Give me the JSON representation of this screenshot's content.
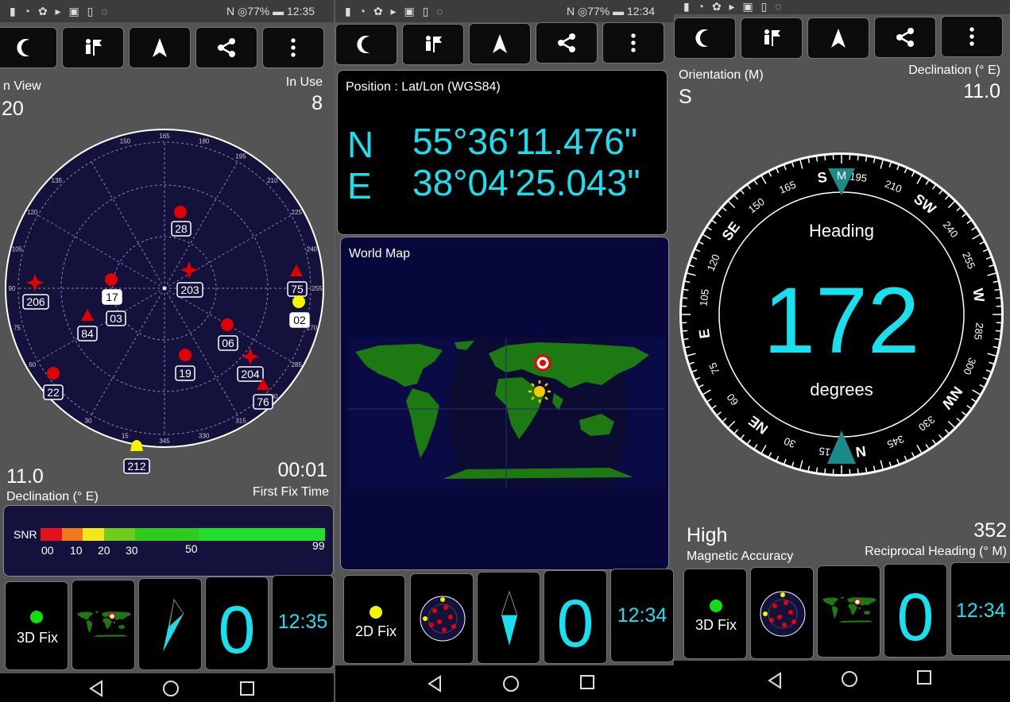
{
  "screens": [
    {
      "status": {
        "left": "▮ ◔ ✿ ▸ ▣ ▯ ◌",
        "right": "N ◎77% ▬ 12:35"
      },
      "toolbar": {
        "icons": [
          "night-mode-icon",
          "poi-icon",
          "navigate-icon",
          "share-icon",
          "more-vert-icon"
        ]
      },
      "in_view_label": "n View",
      "in_view_value": "20",
      "in_use_label": "In Use",
      "in_use_value": "8",
      "sky": {
        "azimuth_ticks": [
          "150",
          "165",
          "180",
          "195",
          "210",
          "225",
          "240",
          "255",
          "270",
          "285",
          "300",
          "315",
          "330",
          "345",
          "15",
          "30",
          "45",
          "60",
          "75",
          "90",
          "105",
          "120",
          "135"
        ],
        "satellites": [
          {
            "id": "28",
            "shape": "circle",
            "color": "#e00000"
          },
          {
            "id": "203",
            "shape": "star",
            "color": "#e00000"
          },
          {
            "id": "206",
            "shape": "star",
            "color": "#e00000"
          },
          {
            "id": "17",
            "shape": "circle",
            "color": "#e00000",
            "highlight": true
          },
          {
            "id": "03",
            "shape": "none",
            "color": "#e00000"
          },
          {
            "id": "84",
            "shape": "triangle",
            "color": "#e00000"
          },
          {
            "id": "75",
            "shape": "triangle",
            "color": "#e00000"
          },
          {
            "id": "02",
            "shape": "circle",
            "color": "#f5f500",
            "highlight": true
          },
          {
            "id": "06",
            "shape": "circle",
            "color": "#e00000"
          },
          {
            "id": "19",
            "shape": "circle",
            "color": "#e00000"
          },
          {
            "id": "204",
            "shape": "star",
            "color": "#e00000"
          },
          {
            "id": "22",
            "shape": "circle",
            "color": "#e00000"
          },
          {
            "id": "76",
            "shape": "triangle",
            "color": "#e00000"
          },
          {
            "id": "212",
            "shape": "bell",
            "color": "#f5f500"
          }
        ]
      },
      "declination_value": "11.0",
      "declination_label": "Declination (° E)",
      "first_fix_value": "00:01",
      "first_fix_label": "First Fix Time",
      "snr": {
        "label": "SNR",
        "ticks": [
          "00",
          "10",
          "20",
          "30",
          "50",
          "99"
        ],
        "colors": [
          "#e5101a",
          "#f07a1a",
          "#f5e61a",
          "#6fcd1a",
          "#2ccd1a",
          "#1fe02a"
        ]
      },
      "tiles": {
        "fix_label": "3D Fix",
        "fix_color": "#10e010",
        "count": "0",
        "time": "12:35"
      }
    },
    {
      "status": {
        "left": "▮ ◔ ✿ ▸ ▣ ▯ ◌",
        "right": "N ◎77% ▬ 12:34"
      },
      "position_title": "Position : Lat/Lon (WGS84)",
      "lat_hemisphere": "N",
      "lat_value": "55°36'11.476\"",
      "lon_hemisphere": "E",
      "lon_value": "38°04'25.043\"",
      "world_map_title": "World Map",
      "tiles": {
        "fix_label": "2D Fix",
        "fix_color": "#f5f500",
        "count": "0",
        "time": "12:34"
      }
    },
    {
      "status": {
        "left": "▮ ◔ ✿ ▸ ▣ ▯ ◌",
        "right": ""
      },
      "orientation_label": "Orientation (M)",
      "orientation_value": "S",
      "declination_label": "Declination (° E)",
      "declination_value": "11.0",
      "compass": {
        "heading_label": "Heading",
        "heading_value": "172",
        "units": "degrees",
        "marker": "M",
        "dial": [
          {
            "t": "S",
            "big": true
          },
          {
            "t": "195"
          },
          {
            "t": "210"
          },
          {
            "t": "SW",
            "big": true
          },
          {
            "t": "240"
          },
          {
            "t": "255"
          },
          {
            "t": "W",
            "big": true
          },
          {
            "t": "285"
          },
          {
            "t": "300"
          },
          {
            "t": "NW",
            "big": true
          },
          {
            "t": "330"
          },
          {
            "t": "345"
          },
          {
            "t": "N",
            "big": true
          },
          {
            "t": "15"
          },
          {
            "t": "30"
          },
          {
            "t": "NE",
            "big": true
          },
          {
            "t": "60"
          },
          {
            "t": "75"
          },
          {
            "t": "E",
            "big": true
          },
          {
            "t": "105"
          },
          {
            "t": "120"
          },
          {
            "t": "SE",
            "big": true
          },
          {
            "t": "150"
          },
          {
            "t": "165"
          }
        ]
      },
      "accuracy_value": "High",
      "accuracy_label": "Magnetic Accuracy",
      "reciprocal_value": "352",
      "reciprocal_label": "Reciprocal Heading (° M)",
      "tiles": {
        "fix_label": "3D Fix",
        "fix_color": "#10e010",
        "count": "0",
        "time": "12:34"
      }
    }
  ],
  "colors": {
    "accent": "#18e0ee",
    "sky_bg": "#14123d",
    "map_ocean": "#0a0a44",
    "land": "#1d7a12"
  }
}
